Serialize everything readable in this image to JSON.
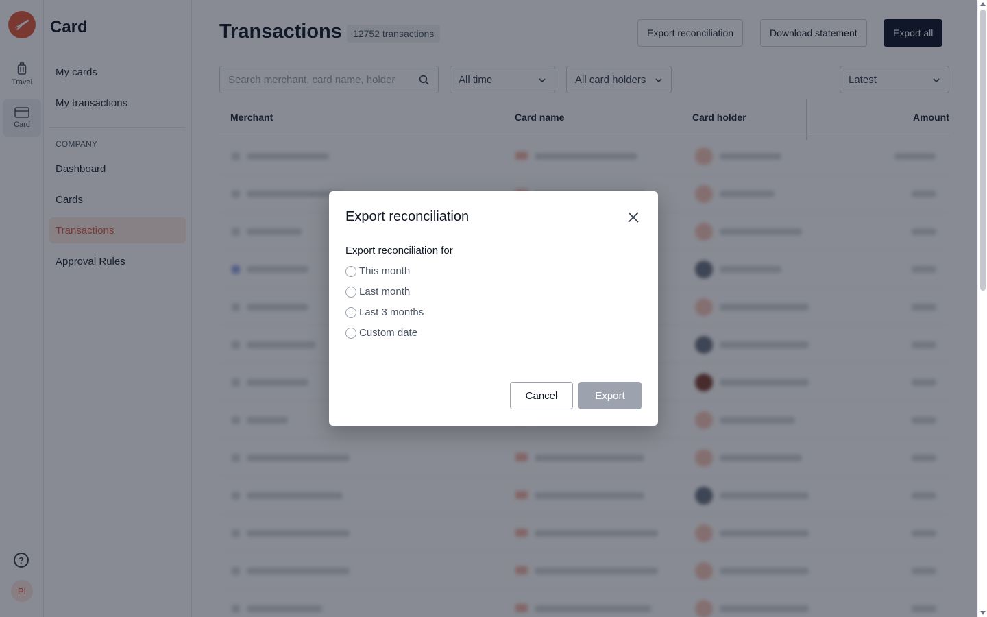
{
  "rail": {
    "items": [
      {
        "label": "Travel",
        "icon": "luggage-icon"
      },
      {
        "label": "Card",
        "icon": "card-icon"
      }
    ],
    "help_icon": "?",
    "avatar_initials": "PI",
    "accent": "#e2583e"
  },
  "sidenav": {
    "title": "Card",
    "personal": [
      "My cards",
      "My transactions"
    ],
    "section_label": "COMPANY",
    "company": [
      "Dashboard",
      "Cards",
      "Transactions",
      "Approval Rules"
    ],
    "active": "Transactions"
  },
  "main": {
    "title": "Transactions",
    "count": "12752 transactions",
    "buttons": {
      "export_reconciliation": "Export reconciliation",
      "download_statement": "Download statement",
      "export_all": "Export all"
    },
    "search_placeholder": "Search merchant, card name, holder",
    "filters": {
      "time": "All time",
      "holders": "All card holders",
      "sort": "Latest"
    },
    "columns": [
      "Merchant",
      "Card name",
      "Card holder",
      "Amount"
    ]
  },
  "modal": {
    "title": "Export reconciliation",
    "label": "Export reconciliation for",
    "options": [
      "This month",
      "Last month",
      "Last 3 months",
      "Custom date"
    ],
    "cancel": "Cancel",
    "export": "Export"
  }
}
